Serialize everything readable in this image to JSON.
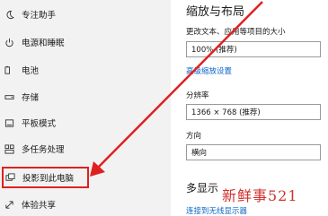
{
  "nav": {
    "items": [
      {
        "label": "专注助手",
        "icon": "moon-icon"
      },
      {
        "label": "电源和睡眠",
        "icon": "power-icon"
      },
      {
        "label": "电池",
        "icon": "battery-icon"
      },
      {
        "label": "存储",
        "icon": "storage-icon"
      },
      {
        "label": "平板模式",
        "icon": "tablet-icon"
      },
      {
        "label": "多任务处理",
        "icon": "multitask-icon"
      },
      {
        "label": "投影到此电脑",
        "icon": "project-icon",
        "selected": true
      },
      {
        "label": "体验共享",
        "icon": "shared-experience-icon"
      }
    ]
  },
  "content": {
    "section1_title": "缩放与布局",
    "scale_label": "更改文本、应用等项目的大小",
    "scale_value": "100% (推荐)",
    "advanced_link": "高级缩放设置",
    "resolution_label": "分辨率",
    "resolution_value": "1366 × 768 (推荐)",
    "orientation_label": "方向",
    "orientation_value": "横向",
    "section2_title": "多显示",
    "connect_link": "连接到无线显示器"
  },
  "watermark": "新鲜事521",
  "colors": {
    "annotation": "#e02020",
    "link": "#0a66c8"
  }
}
